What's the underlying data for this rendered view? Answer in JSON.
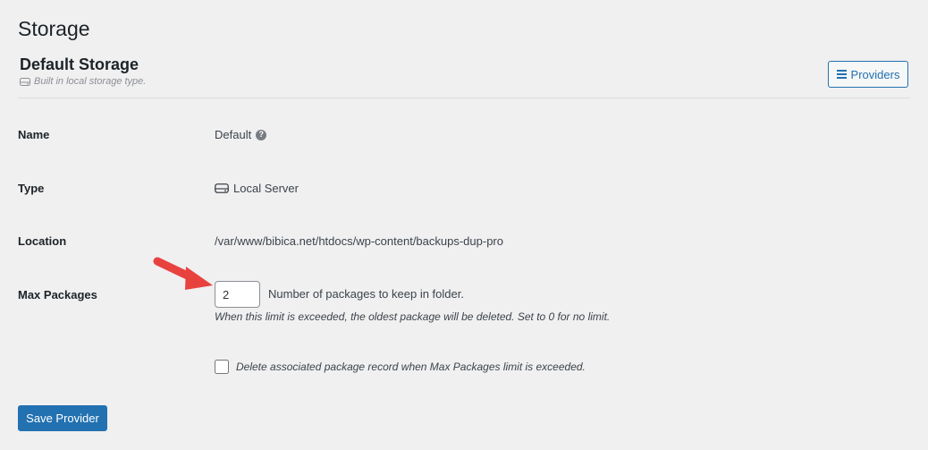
{
  "page": {
    "title": "Storage"
  },
  "storage": {
    "heading": "Default Storage",
    "subtitle": "Built in local storage type.",
    "providers_button": "Providers"
  },
  "fields": {
    "name": {
      "label": "Name",
      "value": "Default"
    },
    "type": {
      "label": "Type",
      "value": "Local Server",
      "icon": "drive-icon"
    },
    "location": {
      "label": "Location",
      "value": "/var/www/bibica.net/htdocs/wp-content/backups-dup-pro"
    },
    "max_packages": {
      "label": "Max Packages",
      "value": "2",
      "description": "Number of packages to keep in folder.",
      "note": "When this limit is exceeded, the oldest package will be deleted. Set to 0 for no limit."
    },
    "delete_record": {
      "label": "Delete associated package record when Max Packages limit is exceeded.",
      "checked": false
    }
  },
  "actions": {
    "save": "Save Provider"
  },
  "colors": {
    "accent": "#2271b1",
    "background": "#f0f0f1",
    "annotation_arrow": "#e8423f"
  }
}
